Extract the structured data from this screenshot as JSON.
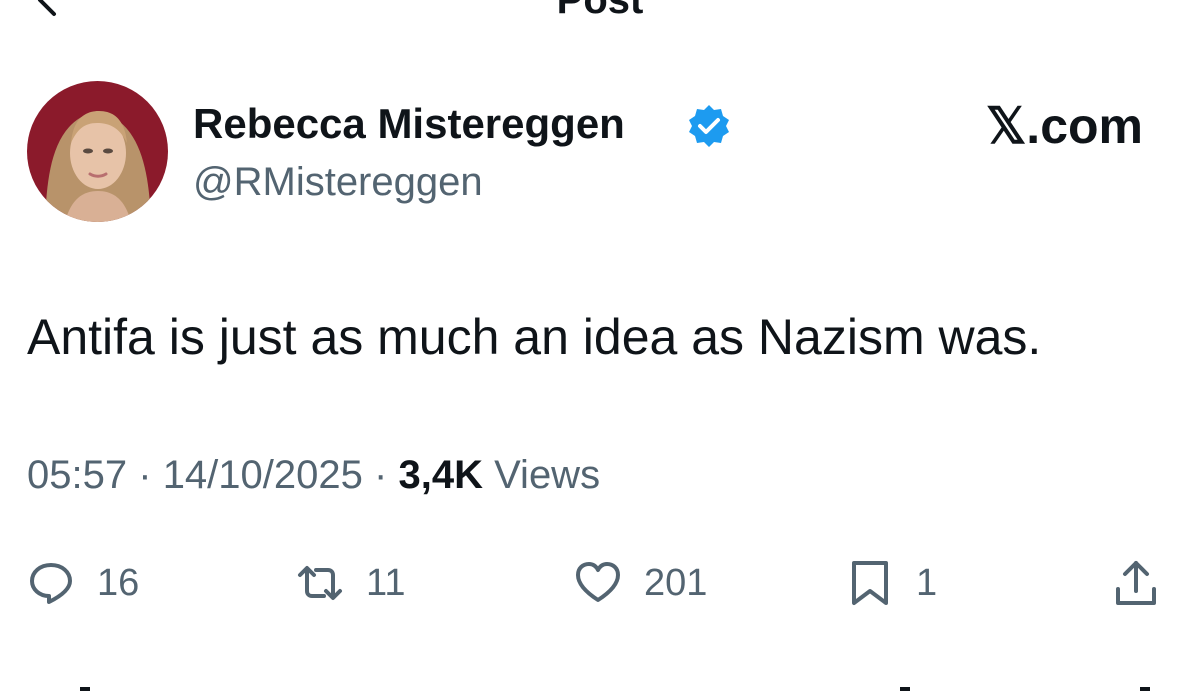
{
  "header": {
    "title": "Post"
  },
  "author": {
    "display_name": "Rebecca Mistereggen",
    "handle": "@RMistereggen",
    "verified": true
  },
  "watermark": "𝕏.com",
  "post": {
    "text": "Antifa is just as much an idea as Nazism was.",
    "time": "05:57",
    "date": "14/10/2025",
    "separator": "·",
    "views_count": "3,4K",
    "views_label": "Views"
  },
  "actions": {
    "reply_count": "16",
    "repost_count": "11",
    "like_count": "201",
    "bookmark_count": "1"
  },
  "colors": {
    "text": "#0f1419",
    "secondary": "#536471",
    "verified": "#1d9bf0",
    "avatar_bg": "#8b1a2b"
  },
  "icons": [
    "back-arrow-icon",
    "more-icon",
    "verified-badge-icon",
    "reply-icon",
    "repost-icon",
    "like-icon",
    "bookmark-icon",
    "share-icon"
  ]
}
